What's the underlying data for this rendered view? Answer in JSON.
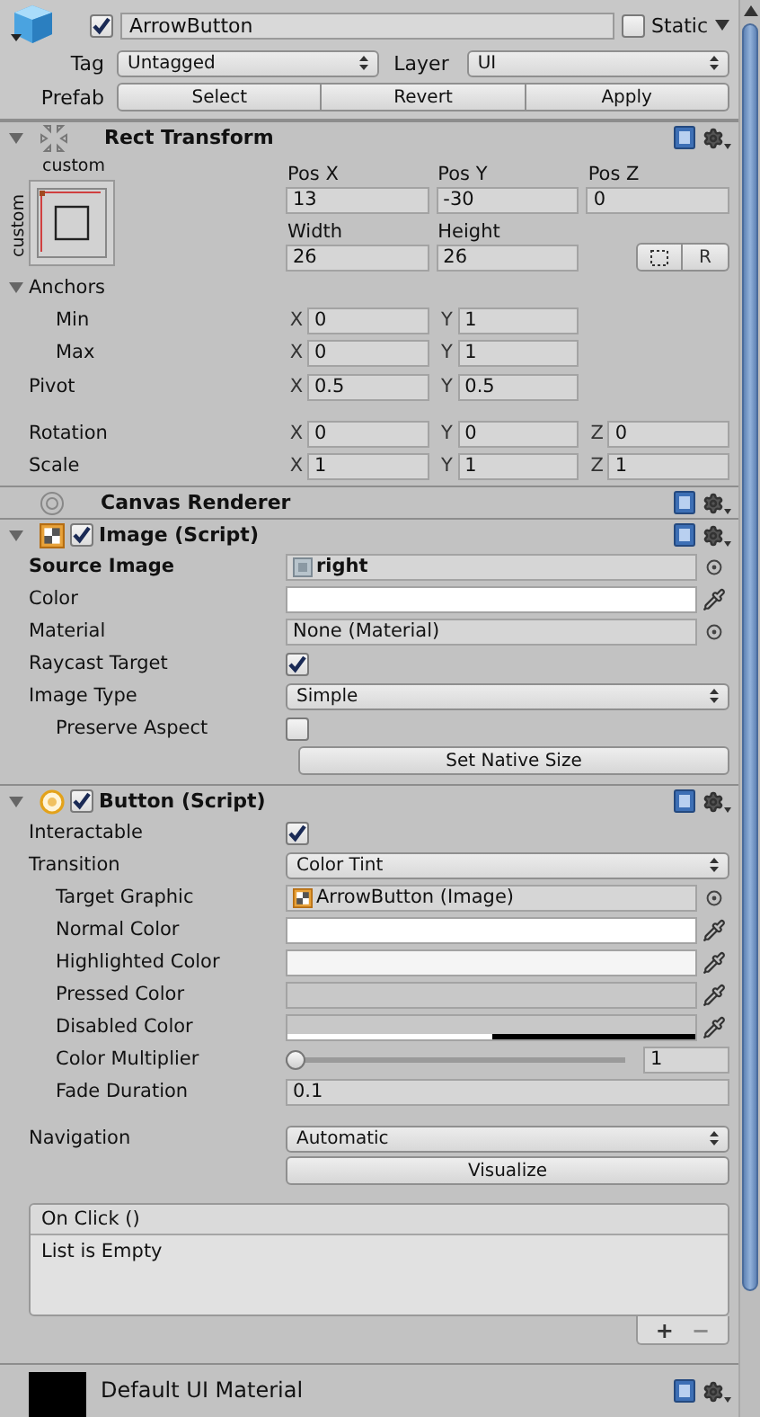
{
  "game_object": {
    "active": true,
    "name": "ArrowButton",
    "static_label": "Static",
    "static": false,
    "tag_label": "Tag",
    "tag": "Untagged",
    "layer_label": "Layer",
    "layer": "UI",
    "prefab_label": "Prefab",
    "prefab_buttons": [
      "Select",
      "Revert",
      "Apply"
    ]
  },
  "components": [
    {
      "kind": "rect_transform",
      "title": "Rect Transform",
      "expanded": true,
      "anchor_preset": {
        "horizontal_label": "custom",
        "vertical_label": "custom"
      },
      "position": [
        {
          "label": "Pos X",
          "value": "13"
        },
        {
          "label": "Pos Y",
          "value": "-30"
        },
        {
          "label": "Pos Z",
          "value": "0"
        }
      ],
      "size": [
        {
          "label": "Width",
          "value": "26"
        },
        {
          "label": "Height",
          "value": "26"
        }
      ],
      "raw_edit_button": "R",
      "anchors": {
        "label": "Anchors",
        "expanded": true,
        "children": [
          {
            "label": "Min",
            "fields": [
              {
                "axis": "X",
                "value": "0"
              },
              {
                "axis": "Y",
                "value": "1"
              }
            ]
          },
          {
            "label": "Max",
            "fields": [
              {
                "axis": "X",
                "value": "0"
              },
              {
                "axis": "Y",
                "value": "1"
              }
            ]
          }
        ]
      },
      "pivot": {
        "label": "Pivot",
        "fields": [
          {
            "axis": "X",
            "value": "0.5"
          },
          {
            "axis": "Y",
            "value": "0.5"
          }
        ]
      },
      "rotation_scale": [
        {
          "label": "Rotation",
          "fields": [
            {
              "axis": "X",
              "value": "0"
            },
            {
              "axis": "Y",
              "value": "0"
            },
            {
              "axis": "Z",
              "value": "0"
            }
          ]
        },
        {
          "label": "Scale",
          "fields": [
            {
              "axis": "X",
              "value": "1"
            },
            {
              "axis": "Y",
              "value": "1"
            },
            {
              "axis": "Z",
              "value": "1"
            }
          ]
        }
      ]
    },
    {
      "kind": "canvas_renderer",
      "title": "Canvas Renderer"
    },
    {
      "kind": "image_script",
      "title": "Image (Script)",
      "expanded": true,
      "enabled": true,
      "properties": [
        {
          "kind": "sprite_ref",
          "label": "Source Image",
          "value": "right",
          "modified": true
        },
        {
          "kind": "color",
          "label": "Color",
          "color": "#ffffff"
        },
        {
          "kind": "object",
          "label": "Material",
          "value": "None (Material)"
        },
        {
          "kind": "checkbox",
          "label": "Raycast Target",
          "checked": true
        },
        {
          "kind": "dropdown",
          "label": "Image Type",
          "value": "Simple",
          "children": [
            {
              "kind": "checkbox",
              "label": "Preserve Aspect",
              "checked": false
            }
          ]
        },
        {
          "kind": "button",
          "label": "Set Native Size"
        }
      ]
    },
    {
      "kind": "button_script",
      "title": "Button (Script)",
      "expanded": true,
      "enabled": true,
      "properties": [
        {
          "kind": "checkbox",
          "label": "Interactable",
          "checked": true
        },
        {
          "kind": "dropdown",
          "label": "Transition",
          "value": "Color Tint",
          "children": [
            {
              "kind": "component_ref",
              "label": "Target Graphic",
              "value": "ArrowButton (Image)"
            },
            {
              "kind": "color",
              "label": "Normal Color",
              "color": "#ffffff"
            },
            {
              "kind": "color",
              "label": "Highlighted Color",
              "color": "#f5f5f5"
            },
            {
              "kind": "color",
              "label": "Pressed Color",
              "color": "#c8c8c8"
            },
            {
              "kind": "color",
              "label": "Disabled Color",
              "color": "#c8c8c8",
              "level": 0.5
            },
            {
              "kind": "slider",
              "label": "Color Multiplier",
              "level": 0,
              "value": "1"
            },
            {
              "kind": "text",
              "label": "Fade Duration",
              "value": "0.1"
            }
          ]
        }
      ],
      "navigation": {
        "label": "Navigation",
        "value": "Automatic"
      },
      "visualize_button": "Visualize",
      "event": {
        "title": "On Click ()",
        "empty_text": "List is Empty",
        "add_button": "+",
        "remove_button": "−"
      }
    },
    {
      "kind": "material",
      "title": "Default UI Material"
    }
  ]
}
